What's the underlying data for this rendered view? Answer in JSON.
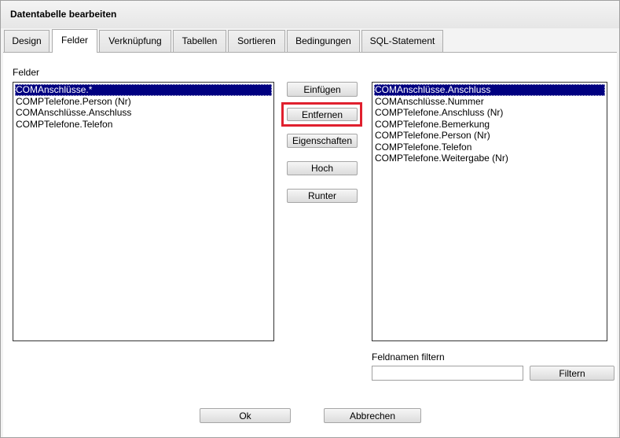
{
  "window": {
    "title": "Datentabelle bearbeiten"
  },
  "tabs": [
    {
      "label": "Design"
    },
    {
      "label": "Felder"
    },
    {
      "label": "Verknüpfung"
    },
    {
      "label": "Tabellen"
    },
    {
      "label": "Sortieren"
    },
    {
      "label": "Bedingungen"
    },
    {
      "label": "SQL-Statement"
    }
  ],
  "active_tab": "Felder",
  "fields_label": "Felder",
  "left_list": {
    "items": [
      "COMAnschlüsse.*",
      "COMPTelefone.Person (Nr)",
      "COMAnschlüsse.Anschluss",
      "COMPTelefone.Telefon"
    ],
    "selected": "COMAnschlüsse.*"
  },
  "right_list": {
    "items": [
      "COMAnschlüsse.Anschluss",
      "COMAnschlüsse.Nummer",
      "COMPTelefone.Anschluss (Nr)",
      "COMPTelefone.Bemerkung",
      "COMPTelefone.Person (Nr)",
      "COMPTelefone.Telefon",
      "COMPTelefone.Weitergabe (Nr)"
    ],
    "selected": "COMAnschlüsse.Anschluss"
  },
  "buttons": {
    "insert": "Einfügen",
    "remove": "Entfernen",
    "properties": "Eigenschaften",
    "up": "Hoch",
    "down": "Runter",
    "filter": "Filtern",
    "ok": "Ok",
    "cancel": "Abbrechen"
  },
  "filter": {
    "label": "Feldnamen filtern",
    "value": ""
  },
  "colors": {
    "selection": "#000080",
    "highlight": "#e0202e"
  }
}
